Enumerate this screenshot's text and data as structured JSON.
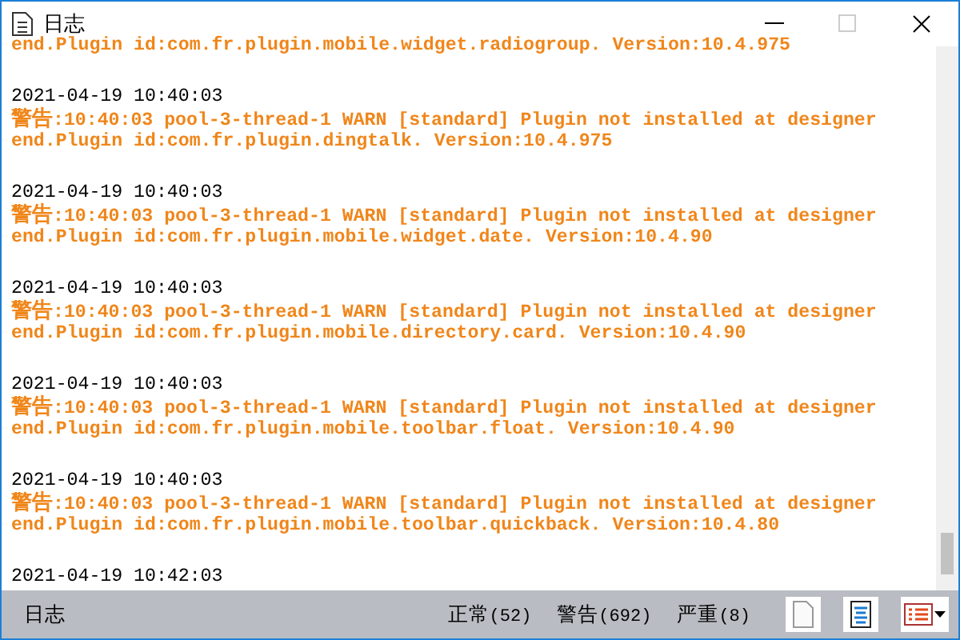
{
  "window": {
    "title": "日志"
  },
  "log": [
    {
      "kind": "tail",
      "lines": [
        "end.Plugin id:com.fr.plugin.mobile.widget.radiogroup. Version:10.4.975"
      ]
    },
    {
      "kind": "warn",
      "time": "2021-04-19 10:40:03",
      "label": "警告",
      "lines": [
        ":10:40:03 pool-3-thread-1 WARN [standard] Plugin not installed at designer",
        "end.Plugin id:com.fr.plugin.dingtalk. Version:10.4.975"
      ]
    },
    {
      "kind": "warn",
      "time": "2021-04-19 10:40:03",
      "label": "警告",
      "lines": [
        ":10:40:03 pool-3-thread-1 WARN [standard] Plugin not installed at designer",
        "end.Plugin id:com.fr.plugin.mobile.widget.date. Version:10.4.90"
      ]
    },
    {
      "kind": "warn",
      "time": "2021-04-19 10:40:03",
      "label": "警告",
      "lines": [
        ":10:40:03 pool-3-thread-1 WARN [standard] Plugin not installed at designer",
        "end.Plugin id:com.fr.plugin.mobile.directory.card. Version:10.4.90"
      ]
    },
    {
      "kind": "warn",
      "time": "2021-04-19 10:40:03",
      "label": "警告",
      "lines": [
        ":10:40:03 pool-3-thread-1 WARN [standard] Plugin not installed at designer",
        "end.Plugin id:com.fr.plugin.mobile.toolbar.float. Version:10.4.90"
      ]
    },
    {
      "kind": "warn",
      "time": "2021-04-19 10:40:03",
      "label": "警告",
      "lines": [
        ":10:40:03 pool-3-thread-1 WARN [standard] Plugin not installed at designer",
        "end.Plugin id:com.fr.plugin.mobile.toolbar.quickback. Version:10.4.80"
      ]
    },
    {
      "kind": "time",
      "time": "2021-04-19 10:42:03"
    }
  ],
  "status_bar": {
    "label": "日志",
    "counts": [
      {
        "name": "正常",
        "count": "(52)"
      },
      {
        "name": "警告",
        "count": "(692)"
      },
      {
        "name": "严重",
        "count": "(8)"
      }
    ]
  }
}
